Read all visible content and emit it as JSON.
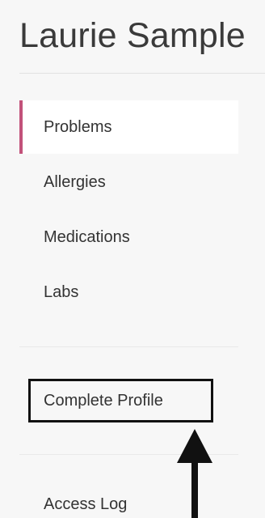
{
  "patient": {
    "name": "Laurie Sample"
  },
  "nav": {
    "items": [
      {
        "label": "Problems",
        "active": true
      },
      {
        "label": "Allergies",
        "active": false
      },
      {
        "label": "Medications",
        "active": false
      },
      {
        "label": "Labs",
        "active": false
      }
    ],
    "complete_profile_label": "Complete Profile",
    "access_log_label": "Access Log"
  },
  "annotation": {
    "arrow_icon": "arrow-up-icon",
    "highlight_color": "#111111"
  },
  "colors": {
    "background": "#f7f7f7",
    "active_accent": "#c2527a",
    "active_background": "#ffffff",
    "text": "#333333"
  }
}
